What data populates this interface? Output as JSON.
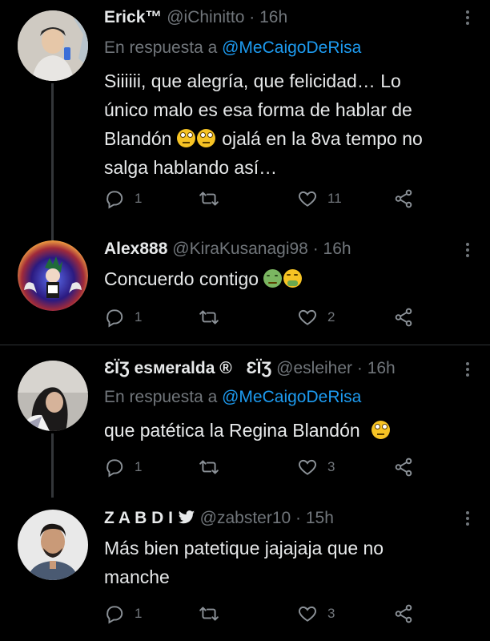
{
  "tweets": [
    {
      "name": "Erick™",
      "handle": "@iChinitto",
      "time": "16h",
      "reply_prefix": "En respuesta a",
      "reply_to": "@MeCaigoDeRisa",
      "text_lines": [
        "Siiiiii, que alegría, que felicidad… Lo",
        "único malo es esa forma de hablar de",
        "Blandón",
        "ojalá en la 8va tempo no",
        "salga hablando así…"
      ],
      "replies": "1",
      "retweets": "",
      "likes": "11"
    },
    {
      "name": "Alex888",
      "handle": "@KiraKusanagi98",
      "time": "16h",
      "text": "Concuerdo contigo",
      "replies": "1",
      "retweets": "",
      "likes": "2"
    },
    {
      "name": "ƐЇƷ esмeralda ®",
      "name_suffix": "ƐЇƷ",
      "handle": "@esleiher",
      "time": "16h",
      "reply_prefix": "En respuesta a",
      "reply_to": "@MeCaigoDeRisa",
      "text": "que patética la Regina Blandón",
      "replies": "1",
      "retweets": "",
      "likes": "3"
    },
    {
      "name": "Z A B D I",
      "handle": "@zabster10",
      "time": "15h",
      "text_lines": [
        "Más bien patetique jajajaja que no",
        "manche"
      ],
      "replies": "1",
      "retweets": "",
      "likes": "3"
    }
  ],
  "separator": "·",
  "icons": [
    "reply-icon",
    "retweet-icon",
    "like-icon",
    "share-icon",
    "more-icon",
    "twitter-bird-icon",
    "eye-roll-emoji",
    "nauseated-emoji",
    "vomit-emoji"
  ],
  "colors": {
    "background": "#000000",
    "text": "#e7e9ea",
    "secondary": "#71767b",
    "accent": "#1d9bf0"
  }
}
